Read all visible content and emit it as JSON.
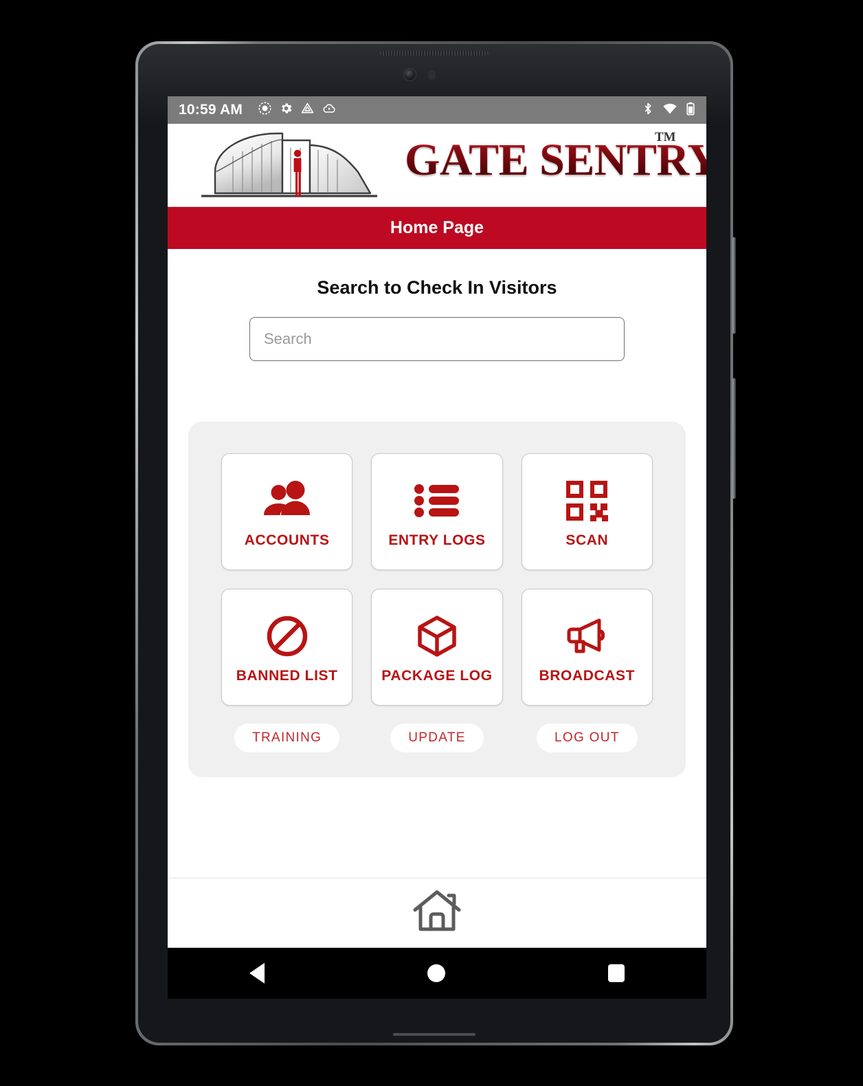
{
  "status_bar": {
    "time": "10:59 AM",
    "left_icons": [
      "screen-record-icon",
      "settings-gear-icon",
      "drive-icon",
      "cloud-sync-icon"
    ],
    "right_icons": [
      "bluetooth-icon",
      "wifi-icon",
      "battery-icon"
    ]
  },
  "brand": {
    "name": "GATE SENTRY",
    "trademark": "TM",
    "logo_alt": "gate-sentry-logo"
  },
  "title_bar": {
    "title": "Home Page"
  },
  "search": {
    "heading": "Search to Check In Visitors",
    "placeholder": "Search",
    "value": ""
  },
  "tiles": [
    {
      "label": "ACCOUNTS",
      "icon": "people-icon",
      "lines": 1
    },
    {
      "label": "ENTRY LOGS",
      "icon": "list-icon",
      "lines": 1
    },
    {
      "label": "SCAN",
      "icon": "qr-code-icon",
      "lines": 1
    },
    {
      "label": "BANNED LIST",
      "icon": "prohibited-icon",
      "lines": 2
    },
    {
      "label": "PACKAGE LOG",
      "icon": "box-icon",
      "lines": 2
    },
    {
      "label": "BROADCAST",
      "icon": "megaphone-icon",
      "lines": 1
    }
  ],
  "pills": [
    {
      "label": "TRAINING"
    },
    {
      "label": "UPDATE"
    },
    {
      "label": "LOG OUT"
    }
  ],
  "bottom_nav": {
    "home_icon": "house-icon"
  },
  "system_nav": {
    "back": "back-triangle-icon",
    "home": "home-circle-icon",
    "recents": "recents-square-icon"
  },
  "colors": {
    "brand_red": "#bd0a22",
    "icon_red": "#b81414",
    "pill_red": "#c2282a",
    "panel_gray": "#f0f0f0",
    "status_bar_gray": "#7b7b7b"
  }
}
